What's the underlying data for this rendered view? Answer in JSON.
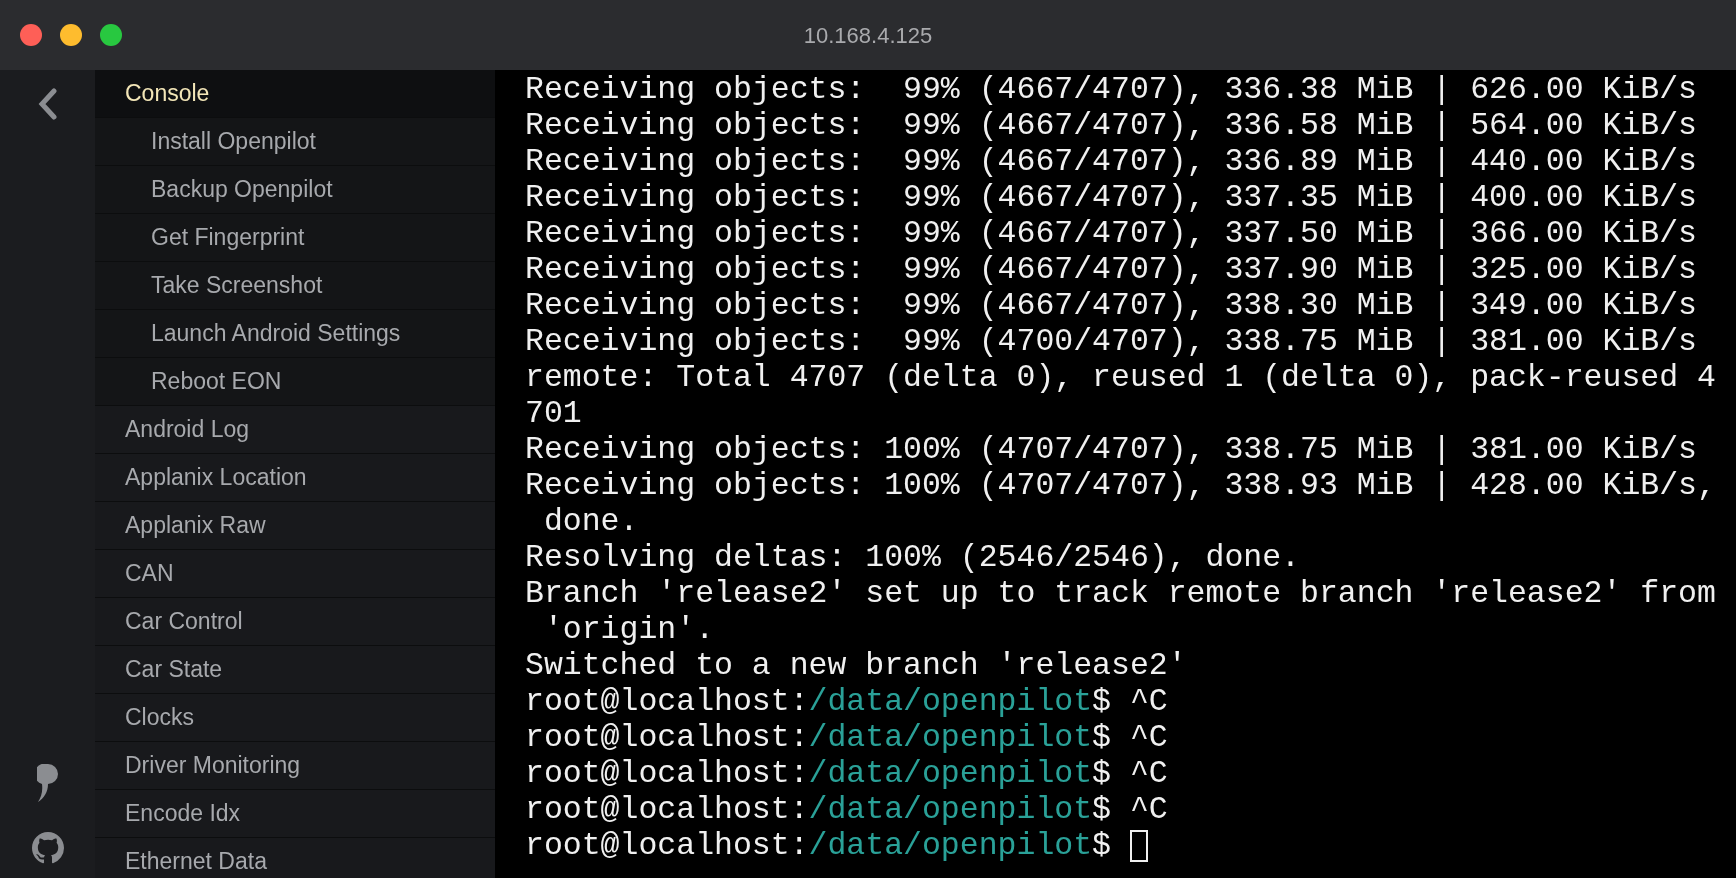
{
  "window": {
    "title": "10.168.4.125"
  },
  "sidebar": {
    "items": [
      {
        "label": "Console",
        "selected": true,
        "children": [
          {
            "label": "Install Openpilot",
            "selected": false
          },
          {
            "label": "Backup Openpilot",
            "selected": false
          },
          {
            "label": "Get Fingerprint",
            "selected": false
          },
          {
            "label": "Take Screenshot",
            "selected": false
          },
          {
            "label": "Launch Android Settings",
            "selected": false
          },
          {
            "label": "Reboot EON",
            "selected": false
          }
        ]
      },
      {
        "label": "Android Log",
        "selected": false
      },
      {
        "label": "Applanix Location",
        "selected": false
      },
      {
        "label": "Applanix Raw",
        "selected": false
      },
      {
        "label": "CAN",
        "selected": false
      },
      {
        "label": "Car Control",
        "selected": false
      },
      {
        "label": "Car State",
        "selected": false
      },
      {
        "label": "Clocks",
        "selected": false
      },
      {
        "label": "Driver Monitoring",
        "selected": false
      },
      {
        "label": "Encode Idx",
        "selected": false
      },
      {
        "label": "Ethernet Data",
        "selected": false
      }
    ]
  },
  "terminal": {
    "lines": [
      {
        "kind": "output",
        "text": "Receiving objects:  99% (4667/4707), 336.38 MiB | 626.00 KiB/s"
      },
      {
        "kind": "output",
        "text": "Receiving objects:  99% (4667/4707), 336.58 MiB | 564.00 KiB/s"
      },
      {
        "kind": "output",
        "text": "Receiving objects:  99% (4667/4707), 336.89 MiB | 440.00 KiB/s"
      },
      {
        "kind": "output",
        "text": "Receiving objects:  99% (4667/4707), 337.35 MiB | 400.00 KiB/s"
      },
      {
        "kind": "output",
        "text": "Receiving objects:  99% (4667/4707), 337.50 MiB | 366.00 KiB/s"
      },
      {
        "kind": "output",
        "text": "Receiving objects:  99% (4667/4707), 337.90 MiB | 325.00 KiB/s"
      },
      {
        "kind": "output",
        "text": "Receiving objects:  99% (4667/4707), 338.30 MiB | 349.00 KiB/s"
      },
      {
        "kind": "output",
        "text": "Receiving objects:  99% (4700/4707), 338.75 MiB | 381.00 KiB/s"
      },
      {
        "kind": "output",
        "text": "remote: Total 4707 (delta 0), reused 1 (delta 0), pack-reused 4"
      },
      {
        "kind": "output",
        "text": "701"
      },
      {
        "kind": "output",
        "text": "Receiving objects: 100% (4707/4707), 338.75 MiB | 381.00 KiB/s"
      },
      {
        "kind": "output",
        "text": "Receiving objects: 100% (4707/4707), 338.93 MiB | 428.00 KiB/s,"
      },
      {
        "kind": "output",
        "text": " done."
      },
      {
        "kind": "output",
        "text": "Resolving deltas: 100% (2546/2546), done."
      },
      {
        "kind": "output",
        "text": "Branch 'release2' set up to track remote branch 'release2' from"
      },
      {
        "kind": "output",
        "text": " 'origin'."
      },
      {
        "kind": "output",
        "text": "Switched to a new branch 'release2'"
      },
      {
        "kind": "prompt",
        "user": "root@localhost:",
        "path": "/data/openpilot",
        "rest": "$ ^C",
        "cursor": false
      },
      {
        "kind": "prompt",
        "user": "root@localhost:",
        "path": "/data/openpilot",
        "rest": "$ ^C",
        "cursor": false
      },
      {
        "kind": "prompt",
        "user": "root@localhost:",
        "path": "/data/openpilot",
        "rest": "$ ^C",
        "cursor": false
      },
      {
        "kind": "prompt",
        "user": "root@localhost:",
        "path": "/data/openpilot",
        "rest": "$ ^C",
        "cursor": false
      },
      {
        "kind": "prompt",
        "user": "root@localhost:",
        "path": "/data/openpilot",
        "rest": "$ ",
        "cursor": true
      }
    ]
  }
}
